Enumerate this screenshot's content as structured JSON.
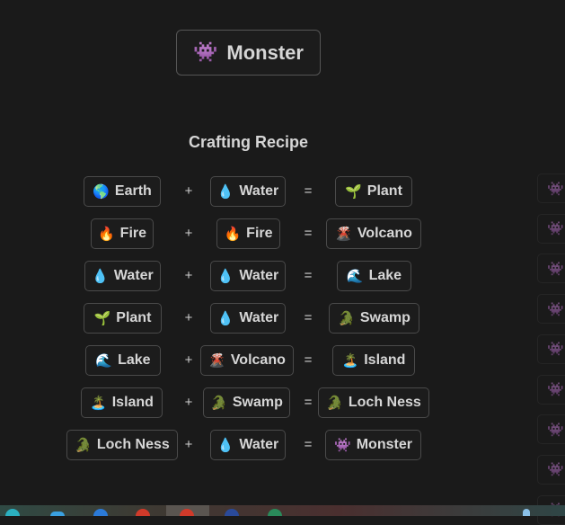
{
  "result": {
    "emoji": "👾",
    "label": "Monster"
  },
  "heading": "Crafting Recipe",
  "operators": {
    "plus": "+",
    "equals": "="
  },
  "recipes": [
    {
      "a": {
        "emoji": "🌎",
        "label": "Earth"
      },
      "b": {
        "emoji": "💧",
        "label": "Water"
      },
      "r": {
        "emoji": "🌱",
        "label": "Plant"
      }
    },
    {
      "a": {
        "emoji": "🔥",
        "label": "Fire"
      },
      "b": {
        "emoji": "🔥",
        "label": "Fire"
      },
      "r": {
        "emoji": "🌋",
        "label": "Volcano"
      }
    },
    {
      "a": {
        "emoji": "💧",
        "label": "Water"
      },
      "b": {
        "emoji": "💧",
        "label": "Water"
      },
      "r": {
        "emoji": "🌊",
        "label": "Lake"
      }
    },
    {
      "a": {
        "emoji": "🌱",
        "label": "Plant"
      },
      "b": {
        "emoji": "💧",
        "label": "Water"
      },
      "r": {
        "emoji": "🐊",
        "label": "Swamp"
      }
    },
    {
      "a": {
        "emoji": "🌊",
        "label": "Lake"
      },
      "b": {
        "emoji": "🌋",
        "label": "Volcano"
      },
      "r": {
        "emoji": "🏝️",
        "label": "Island"
      }
    },
    {
      "a": {
        "emoji": "🏝️",
        "label": "Island"
      },
      "b": {
        "emoji": "🐊",
        "label": "Swamp"
      },
      "r": {
        "emoji": "🐊",
        "label": "Loch Ness"
      }
    },
    {
      "a": {
        "emoji": "🐊",
        "label": "Loch Ness"
      },
      "b": {
        "emoji": "💧",
        "label": "Water"
      },
      "r": {
        "emoji": "👾",
        "label": "Monster"
      }
    }
  ],
  "sidebar_items": [
    {
      "emoji": "👾"
    },
    {
      "emoji": "👾"
    },
    {
      "emoji": "👾"
    },
    {
      "emoji": "👾"
    },
    {
      "emoji": "👾"
    },
    {
      "emoji": "👾"
    },
    {
      "emoji": "👾"
    },
    {
      "emoji": "👾"
    },
    {
      "emoji": "👾"
    }
  ]
}
